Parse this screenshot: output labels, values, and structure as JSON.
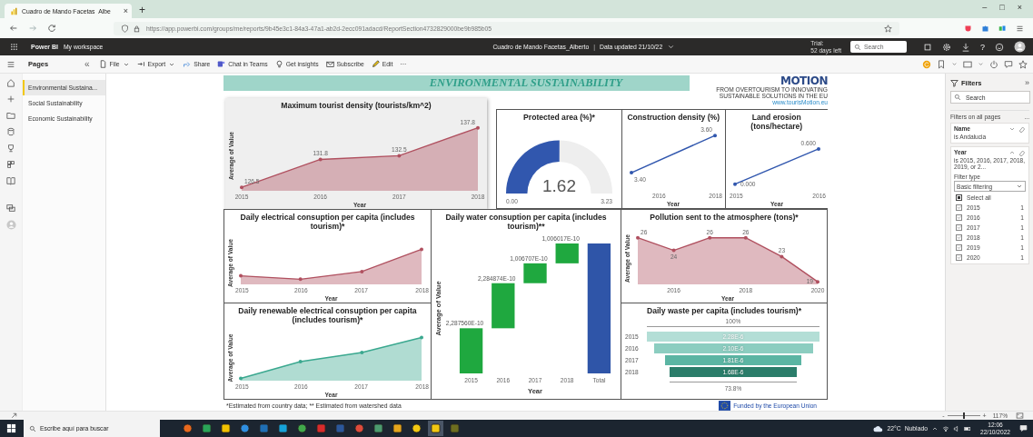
{
  "browser": {
    "tab": {
      "title": "Cuadro de Mando Facetas_Albe",
      "close": "×"
    },
    "new_tab": "+",
    "window_controls": [
      "–",
      "□",
      "×"
    ],
    "url": "https://app.powerbi.com/groups/me/reports/9b45e3c1-84a3-47a1-ab2d-2ecc091adacd/ReportSection4732829000be9b985b05"
  },
  "header": {
    "product": "Power BI",
    "workspace": "My workspace",
    "report_title": "Cuadro de Mando Facetas_Alberto",
    "separator": "|",
    "updated": "Data updated 21/10/22",
    "trial": "Trial:",
    "trial_days": "52 days left",
    "search": {
      "placeholder": "Search"
    },
    "help": "?"
  },
  "toolbar": [
    {
      "label": "File",
      "dropdown": true
    },
    {
      "label": "Export",
      "dropdown": true
    },
    {
      "label": "Share",
      "dropdown": false
    },
    {
      "label": "Chat in Teams",
      "dropdown": false
    },
    {
      "label": "Get insights",
      "dropdown": false
    },
    {
      "label": "Subscribe",
      "dropdown": false
    },
    {
      "label": "Edit",
      "dropdown": false
    },
    {
      "label": "···",
      "dropdown": false
    }
  ],
  "pages_pane": {
    "title": "Pages",
    "collapse": "«",
    "pages": [
      {
        "label": "Environmental Sustaina...",
        "selected": true
      },
      {
        "label": "Social Sustainability",
        "selected": false
      },
      {
        "label": "Economic Sustainability",
        "selected": false
      }
    ]
  },
  "report": {
    "banner": "ENVIRONMENTAL SUSTAINABILITY",
    "logo": {
      "name": "MOTION",
      "tagline": "FROM OVERTOURISM TO INNOVATING SUSTAINABLE SOLUTIONS IN THE EU",
      "url": "www.tourisMotion.eu"
    },
    "visuals": [
      {
        "kind": "area",
        "chart_data": {
          "type": "area",
          "title": "Maximum tourist density (tourists/km^2)",
          "xlabel": "Year",
          "ylabel": "Average of Value",
          "categories": [
            "2015",
            "2016",
            "2017",
            "2018"
          ],
          "series": [
            {
              "color": "#b0505f",
              "values": [
                126.5,
                131.8,
                132.5,
                137.8
              ]
            }
          ],
          "data_labels": true
        }
      },
      {
        "kind": "gauge",
        "title": "Protected area (%)*",
        "value": "1.62",
        "min": "0.00",
        "max": "3.23"
      },
      {
        "kind": "line-picture",
        "title": "Construction density (%)",
        "color": "#3157ae",
        "xlabel": "Year",
        "x_labels": [
          "2016",
          "2018"
        ],
        "point_labels": [
          "3.40",
          "3.60"
        ]
      },
      {
        "kind": "line-picture",
        "title": "Land erosion (tons/hectare)",
        "color": "#3157ae",
        "xlabel": "Year",
        "x_labels": [
          "2015",
          "2016"
        ],
        "point_labels": [
          "0.000",
          "0.600"
        ]
      },
      {
        "kind": "area-picture",
        "title": "Daily electrical consuption per capita (includes tourism)*",
        "color": "#b0505f",
        "xlabel": "Year",
        "ylabel": "Average of Value",
        "x_labels": [
          "2015",
          "2016",
          "2017",
          "2018"
        ]
      },
      {
        "kind": "waterfall",
        "title": "Daily water consuption per capita (includes tourism)**",
        "xlabel": "Year",
        "ylabel": "Average of Value",
        "bars": [
          {
            "kind": "step",
            "label": "2015",
            "value": "2,287560E-10",
            "color": "#1fa83f"
          },
          {
            "kind": "step",
            "label": "2016",
            "value": "2,284874E-10",
            "color": "#1fa83f"
          },
          {
            "kind": "step",
            "label": "2017",
            "value": "1,006707E-10",
            "color": "#1fa83f"
          },
          {
            "kind": "step",
            "label": "2018",
            "value": "1,006017E-10",
            "color": "#1fa83f"
          },
          {
            "kind": "total",
            "label": "Total",
            "color": "#2f55a8"
          }
        ]
      },
      {
        "kind": "area",
        "chart_data": {
          "type": "area",
          "title": "Pollution sent to the atmosphere (tons)*",
          "xlabel": "Year",
          "ylabel": "Average of Value",
          "categories": [
            null,
            "2016",
            null,
            "2018",
            null,
            "2020"
          ],
          "series": [
            {
              "color": "#b0505f",
              "values": [
                26,
                24,
                26,
                26,
                23,
                19
              ]
            }
          ],
          "data_labels": true
        }
      },
      {
        "kind": "area-picture",
        "title": "Daily renewable electrical consuption per capita (includes tourism)*",
        "color": "#3aa88f",
        "xlabel": "Year",
        "ylabel": "Average of Value",
        "x_labels": [
          "2015",
          "2016",
          "2017",
          "2018"
        ]
      },
      {
        "kind": "funnel",
        "title": "Daily waste per capita (includes tourism)*",
        "top_label": "100%",
        "bottom_label": "73.8%",
        "rows": [
          {
            "label": "2015",
            "value": "2.28E-6",
            "color": "#b3ded6"
          },
          {
            "label": "2016",
            "value": "2.10E-6",
            "color": "#8ccdc0"
          },
          {
            "label": "2017",
            "value": "1.81E-6",
            "color": "#5bb5a3"
          },
          {
            "label": "2018",
            "value": "1.68E-6",
            "color": "#2b7d6a"
          }
        ]
      }
    ],
    "footnote": "*Estimated from country data; ** Estimated from watershed data",
    "funding": "Funded by the European Union"
  },
  "filters": {
    "title": "Filters",
    "collapse": "»",
    "search": {
      "placeholder": "Search"
    },
    "section": "Filters on all pages",
    "more": "...",
    "cards": [
      {
        "name": "Name",
        "summary": "is Andalucia",
        "expanded": false
      },
      {
        "name": "Year",
        "summary": "is 2015, 2016, 2017, 2018, 2019, or 2...",
        "expanded": true,
        "filter_type_label": "Filter type",
        "filter_type": "Basic filtering",
        "options": [
          {
            "kind": "select-all",
            "label": "Select all",
            "checked": true
          },
          {
            "kind": "value",
            "label": "2015",
            "count": "1",
            "checked": true
          },
          {
            "kind": "value",
            "label": "2016",
            "count": "1",
            "checked": true
          },
          {
            "kind": "value",
            "label": "2017",
            "count": "1",
            "checked": true
          },
          {
            "kind": "value",
            "label": "2018",
            "count": "1",
            "checked": true
          },
          {
            "kind": "value",
            "label": "2019",
            "count": "1",
            "checked": true
          },
          {
            "kind": "value",
            "label": "2020",
            "count": "1",
            "checked": true
          }
        ]
      }
    ]
  },
  "zoom": {
    "zoom_out": "-",
    "zoom_in": "+",
    "level": 0.5,
    "reading": "117%"
  },
  "taskbar": {
    "search": {
      "placeholder": "Escribe aquí para buscar"
    },
    "weather": "22°C",
    "weather_desc": "Nublado",
    "time": "12:06",
    "date": "22/10/2022"
  }
}
